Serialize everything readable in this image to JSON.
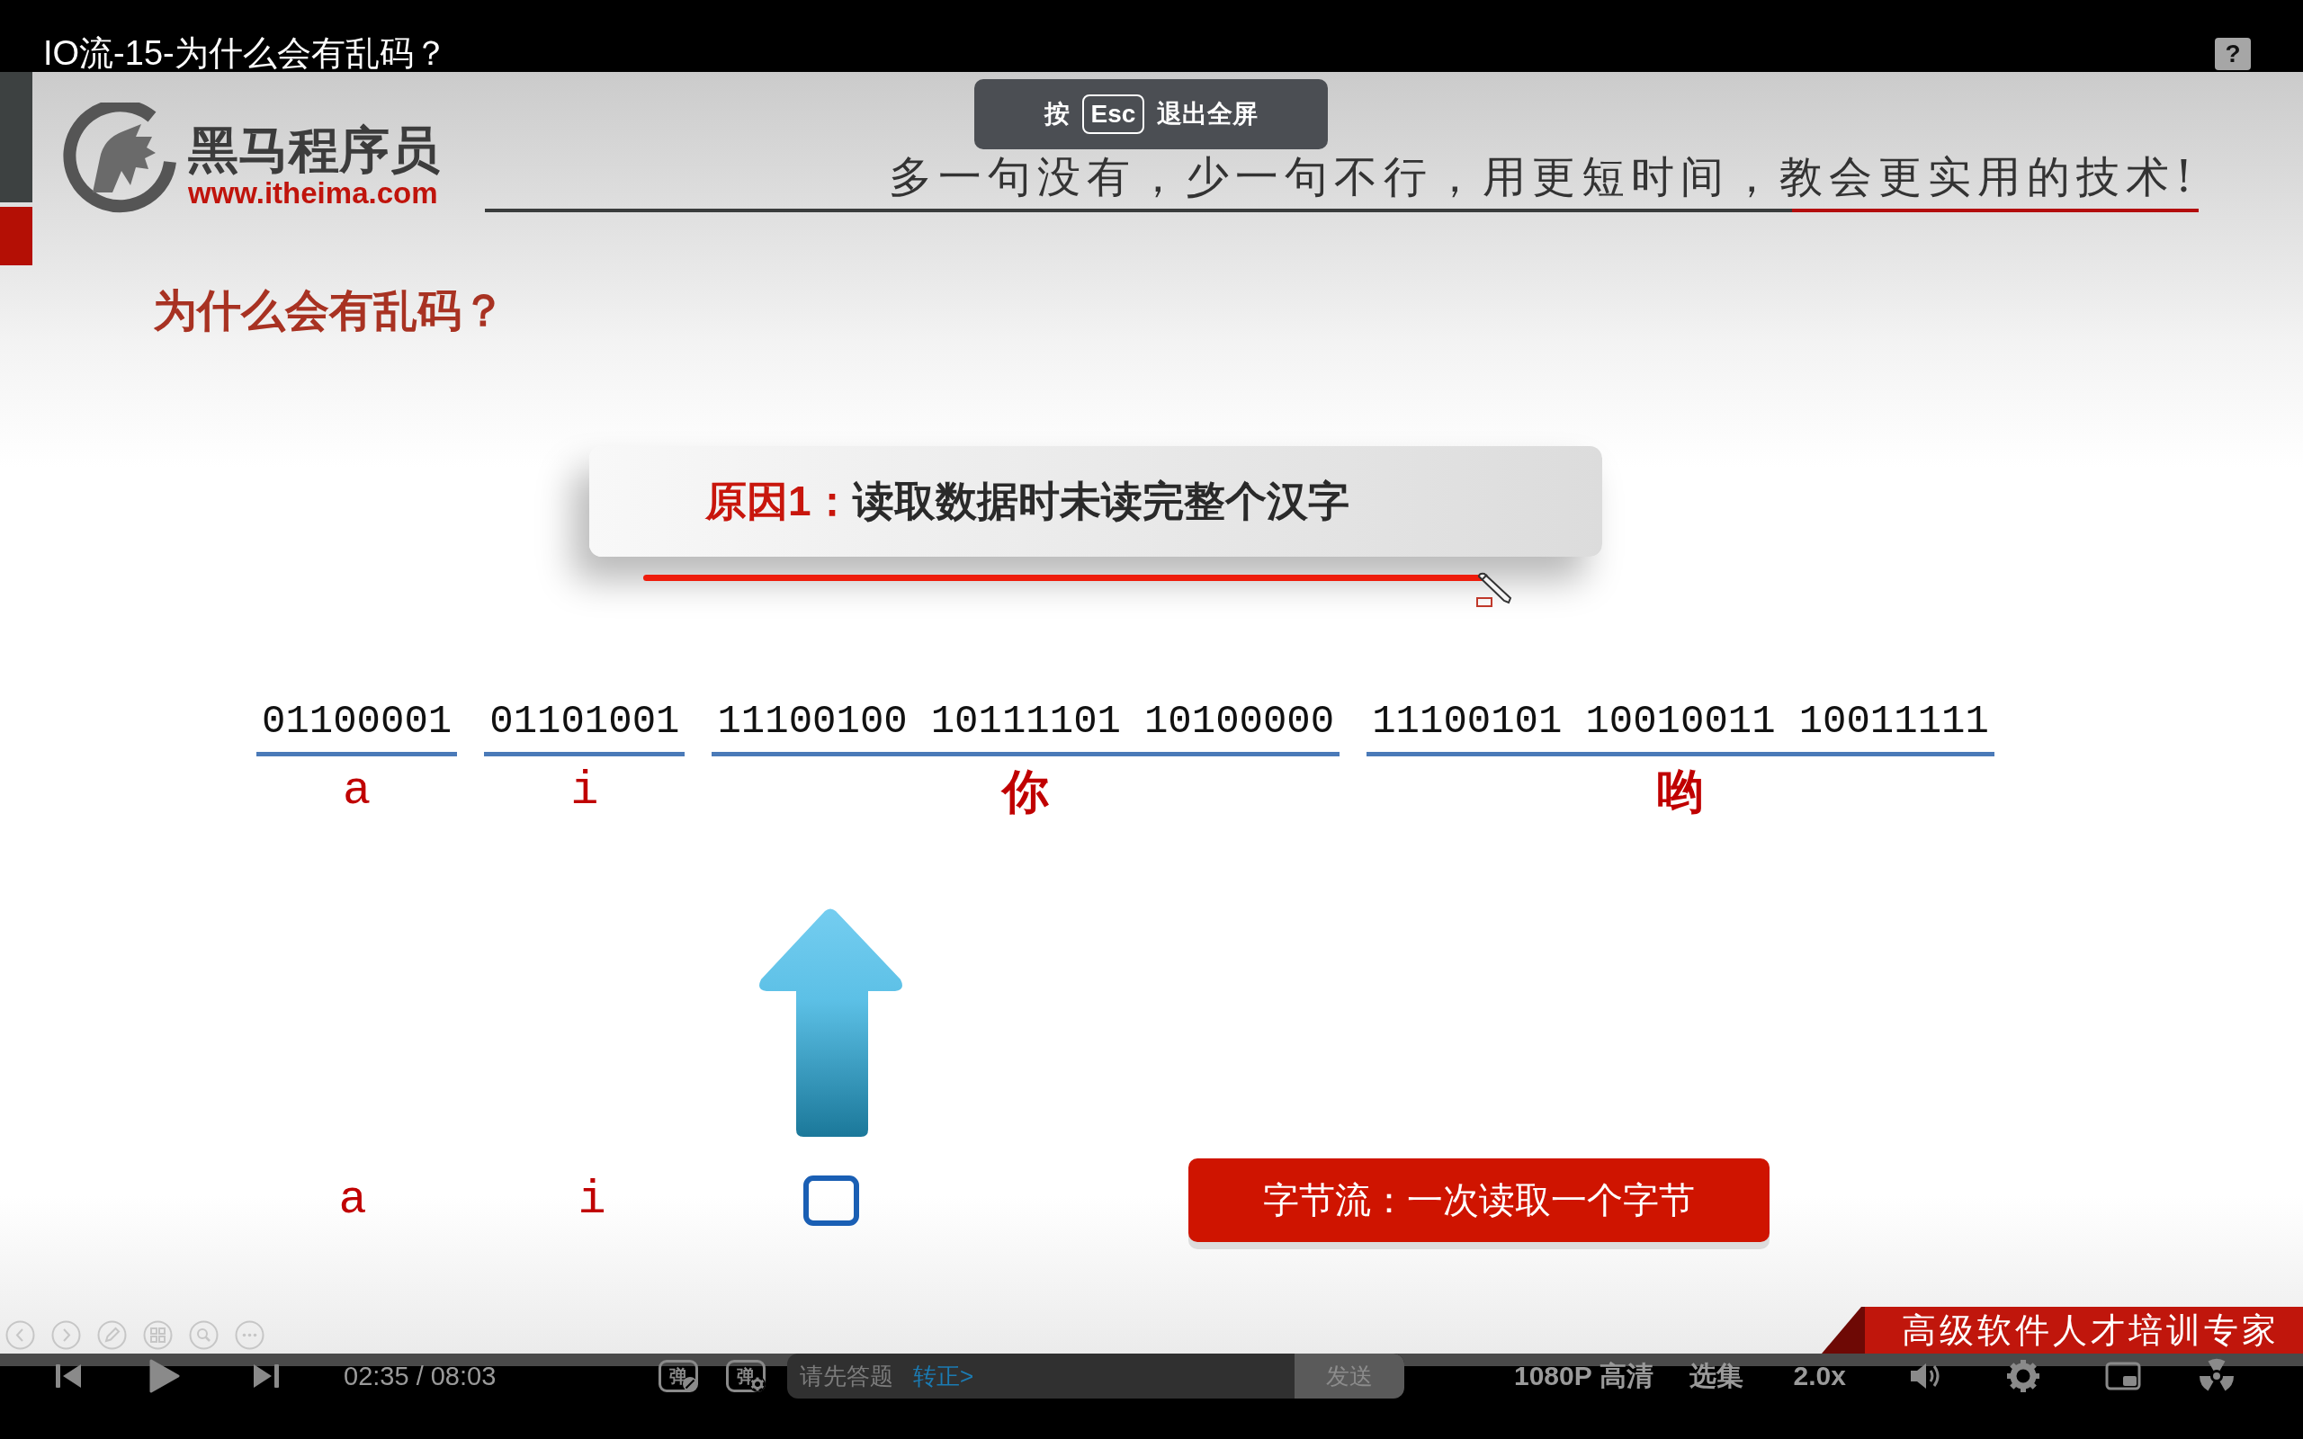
{
  "player": {
    "title": "IO流-15-为什么会有乱码？",
    "help_button": "?"
  },
  "fullscreen_toast": {
    "prefix": "按",
    "key": "Esc",
    "suffix": "退出全屏"
  },
  "slide": {
    "brand": {
      "name": "黑马程序员",
      "url": "www.itheima.com"
    },
    "slogan": "多一句没有，少一句不行，用更短时间，教会更实用的技术!",
    "heading": "为什么会有乱码？",
    "reason": {
      "label": "原因1：",
      "text": "读取数据时未读完整个汉字"
    },
    "byte_groups": [
      {
        "kind": "ascii",
        "bytes": [
          "01100001"
        ],
        "char": "a"
      },
      {
        "kind": "ascii",
        "bytes": [
          "01101001"
        ],
        "char": "i"
      },
      {
        "kind": "chinese",
        "bytes": [
          "11100100",
          "10111101",
          "10100000"
        ],
        "char": "你"
      },
      {
        "kind": "chinese",
        "bytes": [
          "11100101",
          "10010011",
          "10011111"
        ],
        "char": "哟"
      }
    ],
    "read_result": [
      {
        "kind": "char",
        "text": "a"
      },
      {
        "kind": "char",
        "text": "i"
      },
      {
        "kind": "garbled"
      }
    ],
    "note": "字节流：一次读取一个字节",
    "banner": "高级软件人才培训专家"
  },
  "controls": {
    "time": "02:35 / 08:03",
    "danmaku_toggle": "弹",
    "danmaku_settings": "弹",
    "danmaku_input": {
      "placeholder": "请先答题",
      "link": "转正>"
    },
    "send_button": "发送",
    "quality": "1080P 高清",
    "episodes": "选集",
    "speed": "2.0x"
  }
}
